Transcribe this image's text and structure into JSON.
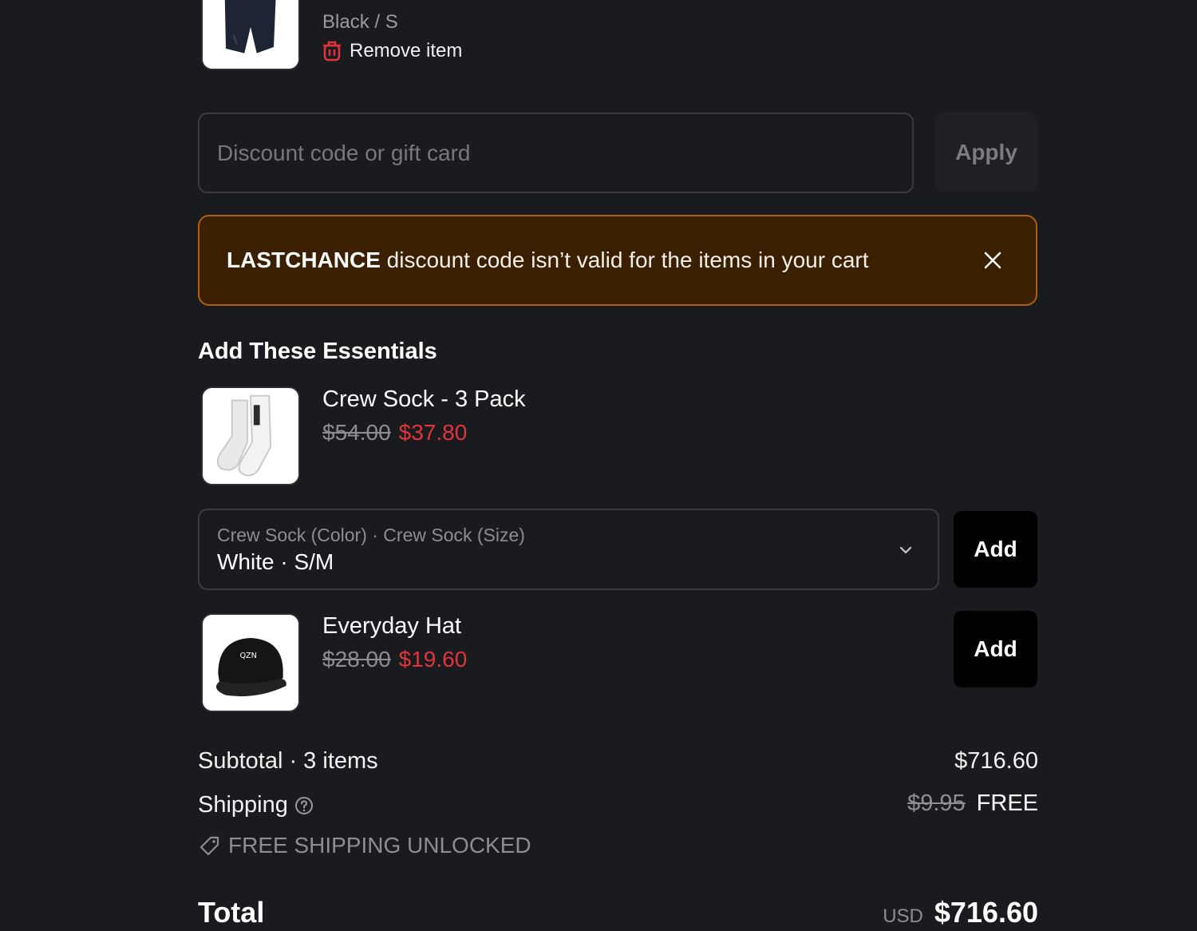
{
  "cart_item": {
    "variant": "Black / S",
    "remove_label": "Remove item"
  },
  "discount": {
    "placeholder": "Discount code or gift card",
    "apply_label": "Apply"
  },
  "alert": {
    "code": "LASTCHANCE",
    "message": " discount code isn’t valid for the items in your cart"
  },
  "essentials": {
    "title": "Add These Essentials",
    "items": [
      {
        "name": "Crew Sock - 3 Pack",
        "old_price": "$54.00",
        "new_price": "$37.80",
        "variant_label": "Crew Sock (Color) · Crew Sock (Size)",
        "variant_value": "White · S/M",
        "add_label": "Add"
      },
      {
        "name": "Everyday Hat",
        "old_price": "$28.00",
        "new_price": "$19.60",
        "add_label": "Add"
      }
    ]
  },
  "summary": {
    "subtotal_label": "Subtotal · 3 items",
    "subtotal_value": "$716.60",
    "shipping_label": "Shipping",
    "shipping_was": "$9.95",
    "shipping_value": "FREE",
    "free_shipping_note": "FREE SHIPPING UNLOCKED",
    "total_label": "Total",
    "currency": "USD",
    "total_value": "$716.60"
  },
  "colors": {
    "background": "#1a1b1e",
    "sale_price": "#e2343a",
    "alert_bg": "#3a1f01",
    "alert_border": "#b05d10"
  },
  "icons": [
    "trash-icon",
    "close-icon",
    "chevron-down-icon",
    "help-icon",
    "tag-icon"
  ]
}
